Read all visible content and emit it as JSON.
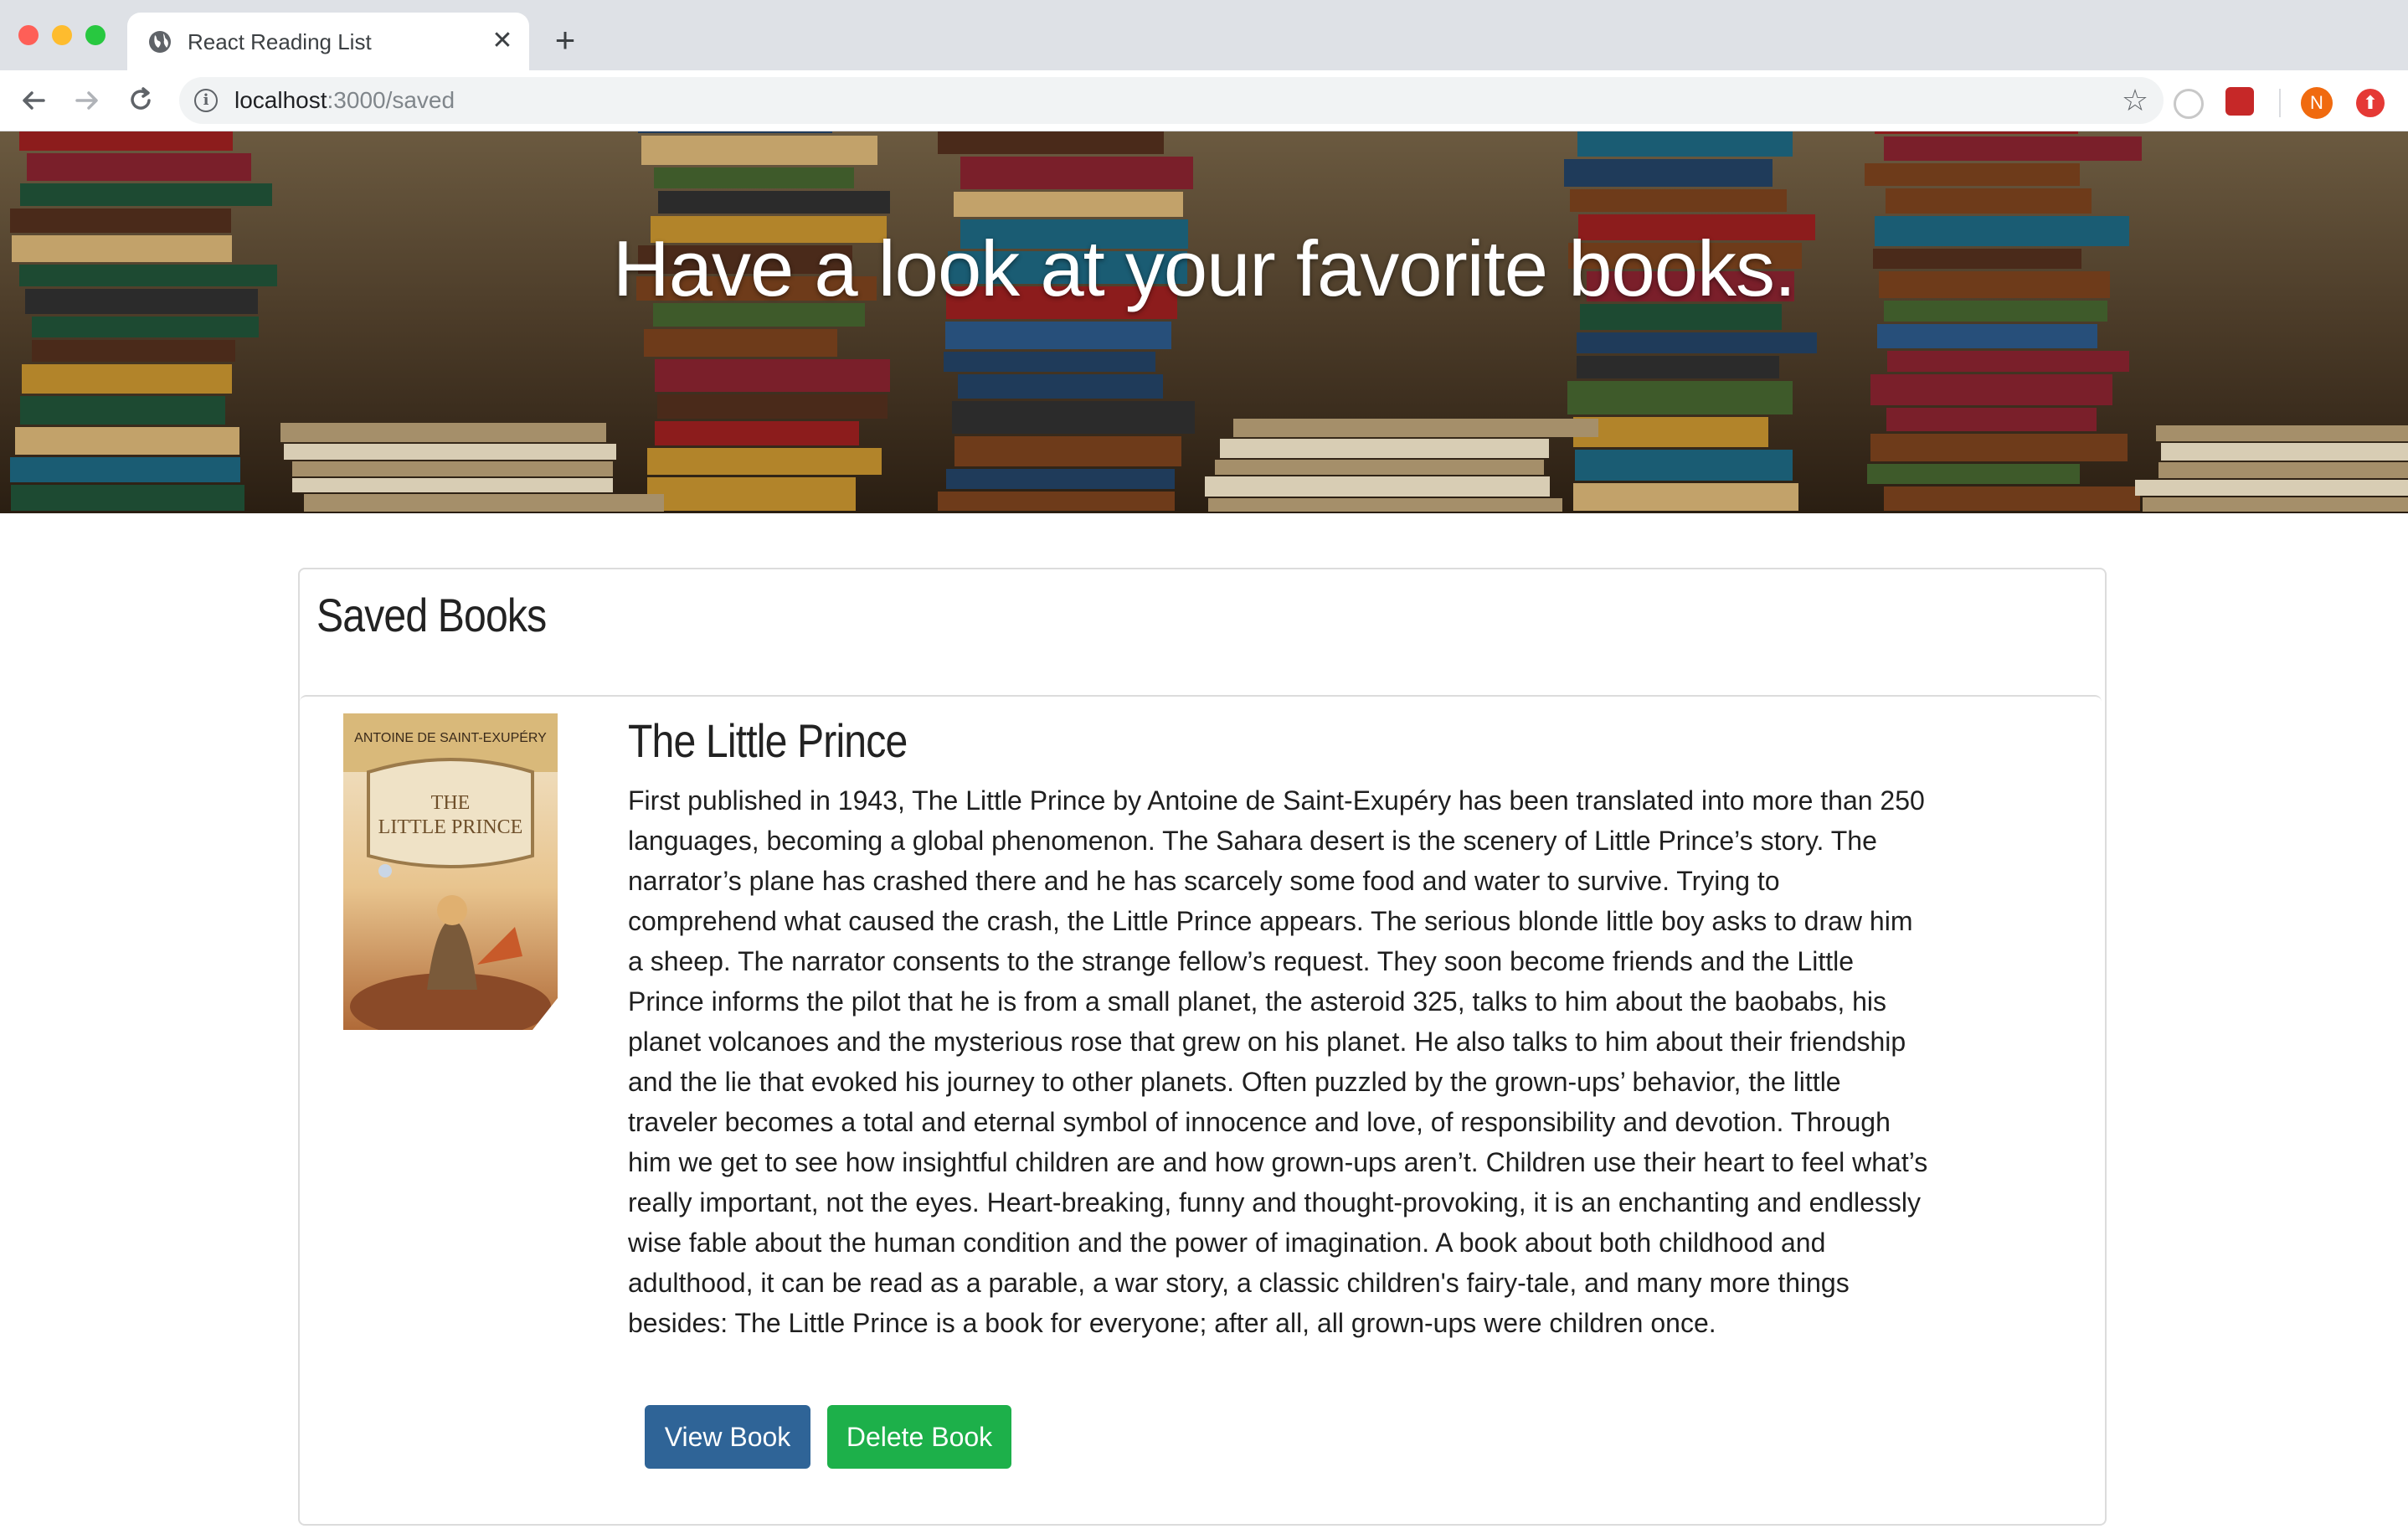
{
  "browser": {
    "tab_title": "React Reading List",
    "new_tab_label": "+",
    "close_label": "✕",
    "url_host": "localhost",
    "url_path": ":3000/saved",
    "avatar_initial": "N",
    "icons": [
      "back-arrow-icon",
      "forward-arrow-icon",
      "reload-icon",
      "info-icon",
      "star-icon",
      "extension-icon",
      "avatar",
      "update-icon"
    ]
  },
  "hero": {
    "title": "Have a look at your favorite books."
  },
  "saved": {
    "heading": "Saved Books",
    "books": [
      {
        "title": "The Little Prince",
        "cover_author": "ANTOINE DE SAINT-EXUPÉRY",
        "cover_title_1": "THE",
        "cover_title_2": "LITTLE PRINCE",
        "description": "First published in 1943, The Little Prince by Antoine de Saint-Exupéry has been translated into more than 250 languages, becoming a global phenomenon. The Sahara desert is the scenery of Little Prince’s story. The narrator’s plane has crashed there and he has scarcely some food and water to survive. Trying to comprehend what caused the crash, the Little Prince appears. The serious blonde little boy asks to draw him a sheep. The narrator consents to the strange fellow’s request. They soon become friends and the Little Prince informs the pilot that he is from a small planet, the asteroid 325, talks to him about the baobabs, his planet volcanoes and the mysterious rose that grew on his planet. He also talks to him about their friendship and the lie that evoked his journey to other planets. Often puzzled by the grown-ups’ behavior, the little traveler becomes a total and eternal symbol of innocence and love, of responsibility and devotion. Through him we get to see how insightful children are and how grown-ups aren’t. Children use their heart to feel what’s really important, not the eyes. Heart-breaking, funny and thought-provoking, it is an enchanting and endlessly wise fable about the human condition and the power of imagination. A book about both childhood and adulthood, it can be read as a parable, a war story, a classic children's fairy-tale, and many more things besides: The Little Prince is a book for everyone; after all, all grown-ups were children once.",
        "view_label": "View Book",
        "delete_label": "Delete Book"
      }
    ]
  },
  "colors": {
    "view_button": "#2f6497",
    "delete_button": "#1db04a",
    "tabbar": "#dee1e6"
  }
}
